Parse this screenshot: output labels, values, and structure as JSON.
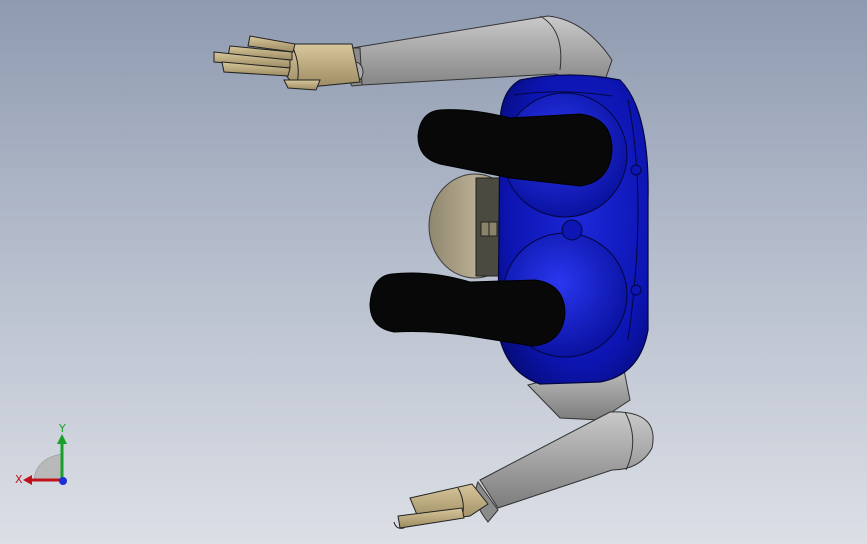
{
  "viewport": {
    "background_top": "#8e9ab0",
    "background_bottom": "#dcdfe6"
  },
  "model": {
    "body_color": "#0a11a8",
    "limb_color": "#9b9b9b",
    "hand_color": "#b8a57e",
    "handle_color": "#050505",
    "wheel_color": "#a99f86"
  },
  "triad": {
    "x_label": "X",
    "y_label": "Y",
    "x_color": "#c0121a",
    "y_color": "#18a02a",
    "z_color": "#1c2fd6"
  }
}
